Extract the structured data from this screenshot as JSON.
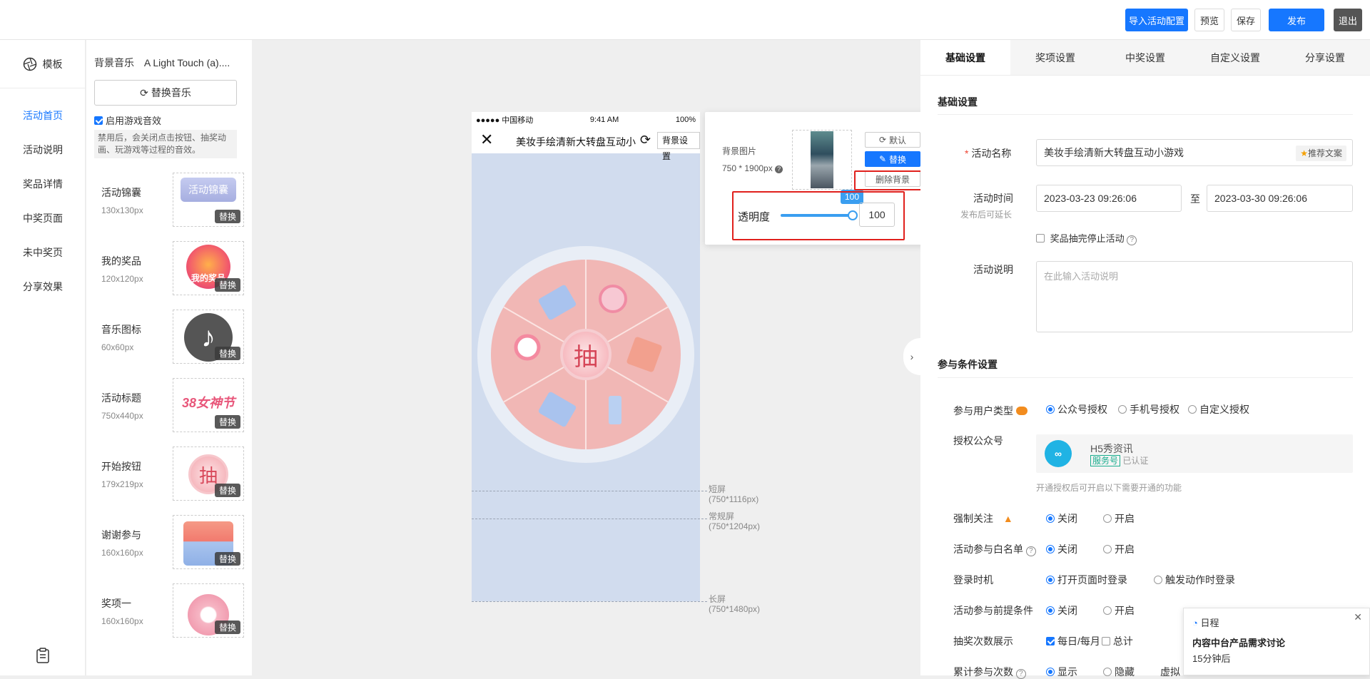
{
  "topbar": {
    "import_label": "导入活动配置",
    "preview_label": "预览",
    "save_label": "保存",
    "publish_label": "发布",
    "exit_label": "退出"
  },
  "leftnav": {
    "header": "模板",
    "items": [
      {
        "label": "活动首页",
        "active": true
      },
      {
        "label": "活动说明"
      },
      {
        "label": "奖品详情"
      },
      {
        "label": "中奖页面"
      },
      {
        "label": "未中奖页"
      },
      {
        "label": "分享效果"
      }
    ]
  },
  "assets": {
    "music_label": "背景音乐",
    "music_name": "A Light Touch (a)....",
    "replace_music": "替换音乐",
    "sound_checkbox": "启用游戏音效",
    "sound_note": "禁用后，会关闭点击按钮、抽奖动画、玩游戏等过程的音效。",
    "replace_tag": "替换",
    "items": [
      {
        "name": "活动锦囊",
        "size": "130x130px",
        "thumb_text": "活动锦囊"
      },
      {
        "name": "我的奖品",
        "size": "120x120px",
        "thumb_text": "我的奖品"
      },
      {
        "name": "音乐图标",
        "size": "60x60px",
        "thumb_text": "♪"
      },
      {
        "name": "活动标题",
        "size": "750x440px",
        "thumb_text": "38女神节"
      },
      {
        "name": "开始按钮",
        "size": "179x219px",
        "thumb_text": "抽"
      },
      {
        "name": "谢谢参与",
        "size": "160x160px",
        "thumb_text": ""
      },
      {
        "name": "奖项一",
        "size": "160x160px",
        "thumb_text": ""
      }
    ]
  },
  "phone": {
    "carrier": "●●●●● 中国移动",
    "time": "9:41 AM",
    "battery": "100%",
    "title": "美妆手绘清新大转盘互动小",
    "bg_setting_btn": "背景设置",
    "wheel_center": "抽"
  },
  "guides": [
    {
      "label": "短屏",
      "size": "(750*1116px)"
    },
    {
      "label": "常规屏",
      "size": "(750*1204px)"
    },
    {
      "label": "长屏",
      "size": "(750*1480px)"
    }
  ],
  "bgpanel": {
    "label": "背景图片",
    "size": "750 * 1900px",
    "default_btn": "默认",
    "replace_btn": "替换",
    "delete_btn": "删除背景",
    "opacity_label": "透明度",
    "opacity_value": "100",
    "opacity_tip": "100",
    "opacity": 1.0
  },
  "right": {
    "tabs": [
      "基础设置",
      "奖项设置",
      "中奖设置",
      "自定义设置",
      "分享设置"
    ],
    "section_basic": "基础设置",
    "name_label": "活动名称",
    "name_value": "美妆手绘清新大转盘互动小游戏",
    "recommend_btn": "推荐文案",
    "time_label": "活动时间",
    "time_note": "发布后可延长",
    "time_start": "2023-03-23 09:26:06",
    "time_to": "至",
    "time_end": "2023-03-30 09:26:06",
    "stop_checkbox": "奖品抽完停止活动",
    "desc_label": "活动说明",
    "desc_placeholder": "在此输入活动说明",
    "section_cond": "参与条件设置",
    "user_type_label": "参与用户类型",
    "user_type_options": [
      "公众号授权",
      "手机号授权",
      "自定义授权"
    ],
    "auth_label": "授权公众号",
    "account_name": "H5秀资讯",
    "account_badge": "服务号",
    "account_verified": "已认证",
    "auth_note": "开通授权后可开启以下需要开通的功能",
    "force_follow_label": "强制关注",
    "whitelist_label": "活动参与白名单",
    "login_label": "登录时机",
    "login_options": [
      "打开页面时登录",
      "触发动作时登录"
    ],
    "precond_label": "活动参与前提条件",
    "off": "关闭",
    "on": "开启",
    "draw_count_label": "抽奖次数展示",
    "draw_count_options": [
      "每日/每月",
      "总计"
    ],
    "cumulative_label": "累计参与次数",
    "show": "显示",
    "hide": "隐藏",
    "virtual_label": "虚拟"
  },
  "toast": {
    "app": "日程",
    "title": "内容中台产品需求讨论",
    "time": "15分钟后"
  }
}
